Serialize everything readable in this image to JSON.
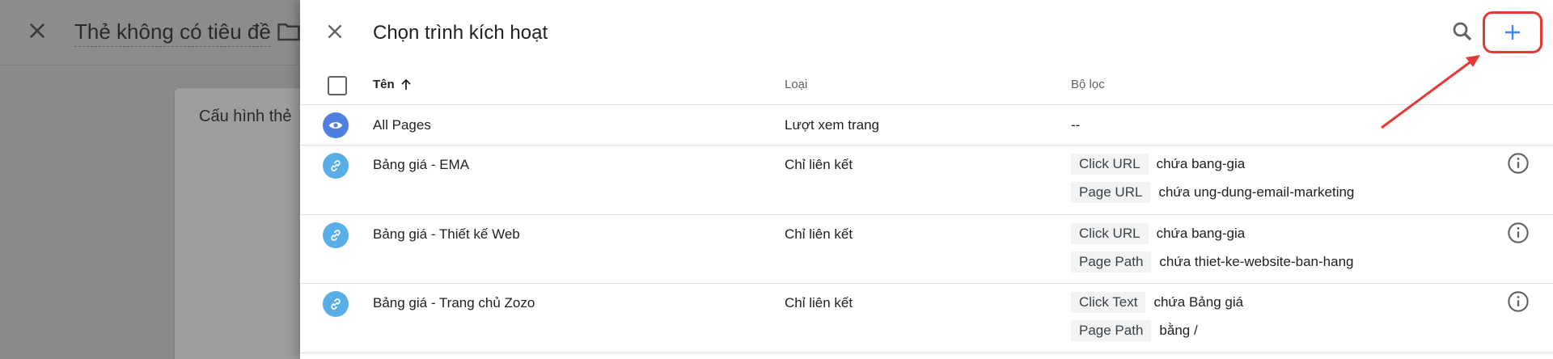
{
  "background": {
    "tag_title": "Thẻ không có tiêu đề",
    "card_title": "Cấu hình thẻ"
  },
  "panel": {
    "title": "Chọn trình kích hoạt",
    "columns": {
      "name": "Tên",
      "type": "Loại",
      "filter": "Bộ lọc"
    },
    "rows": [
      {
        "name": "All Pages",
        "type": "Lượt xem trang",
        "icon": "eye-icon",
        "filter_text": "--",
        "filters": []
      },
      {
        "name": "Bảng giá - EMA",
        "type": "Chỉ liên kết",
        "icon": "link-icon",
        "filters": [
          {
            "variable": "Click URL",
            "condition": "chứa bang-gia"
          },
          {
            "variable": "Page URL",
            "condition": "chứa ung-dung-email-marketing"
          }
        ]
      },
      {
        "name": "Bảng giá - Thiết kế Web",
        "type": "Chỉ liên kết",
        "icon": "link-icon",
        "filters": [
          {
            "variable": "Click URL",
            "condition": "chứa bang-gia"
          },
          {
            "variable": "Page Path",
            "condition": "chứa thiet-ke-website-ban-hang"
          }
        ]
      },
      {
        "name": "Bảng giá - Trang chủ Zozo",
        "type": "Chỉ liên kết",
        "icon": "link-icon",
        "filters": [
          {
            "variable": "Click Text",
            "condition": "chứa Bảng giá"
          },
          {
            "variable": "Page Path",
            "condition": "bằng /"
          }
        ]
      }
    ]
  },
  "colors": {
    "accent": "#4285f4",
    "highlight": "#e53935",
    "view_icon_bg": "#4f7fe0",
    "link_icon_bg": "#5aaee8"
  },
  "icons": [
    "close-icon",
    "folder-icon",
    "search-icon",
    "plus-icon",
    "sort-up-icon",
    "eye-icon",
    "link-icon",
    "info-icon"
  ]
}
